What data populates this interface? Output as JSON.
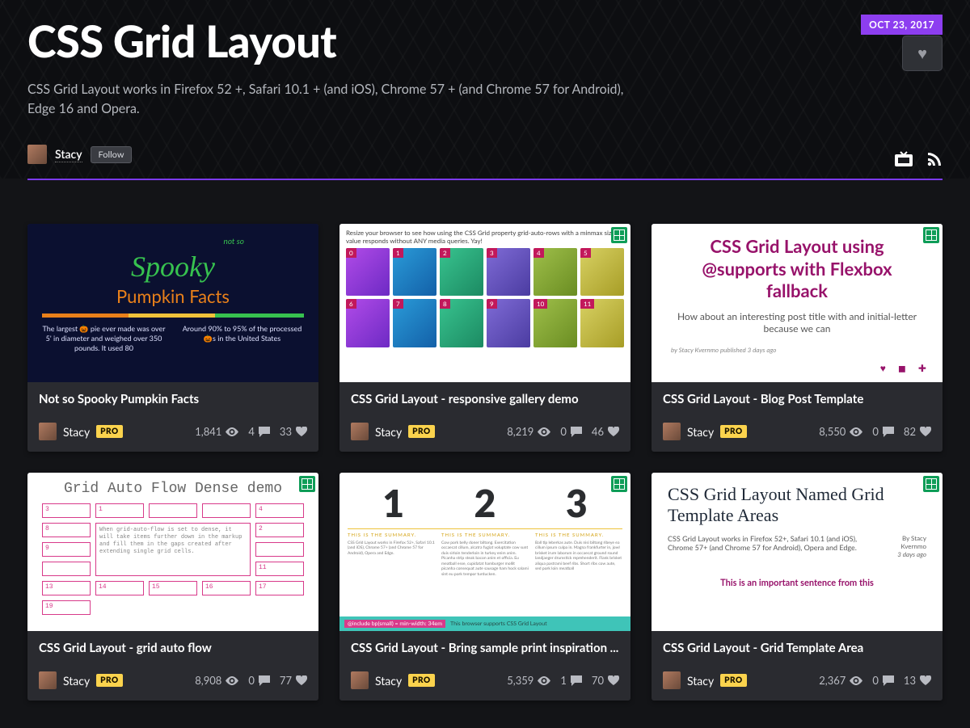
{
  "hero": {
    "date": "OCT 23, 2017",
    "title": "CSS Grid Layout",
    "subtitle": "CSS Grid Layout works in Firefox 52 +, Safari 10.1 + (and iOS), Chrome 57 + (and Chrome 57 for Android), Edge 16 and Opera.",
    "author": "Stacy",
    "follow_label": "Follow"
  },
  "labels": {
    "pro": "PRO"
  },
  "pens": [
    {
      "title": "Not so Spooky Pumpkin Facts",
      "author": "Stacy",
      "pro": true,
      "views": "1,841",
      "comments": "4",
      "loves": "33",
      "grid_badge": false,
      "thumb": "spooky"
    },
    {
      "title": "CSS Grid Layout - responsive gallery demo",
      "author": "Stacy",
      "pro": true,
      "views": "8,219",
      "comments": "0",
      "loves": "46",
      "grid_badge": true,
      "thumb": "gallery"
    },
    {
      "title": "CSS Grid Layout - Blog Post Template",
      "author": "Stacy",
      "pro": true,
      "views": "8,550",
      "comments": "0",
      "loves": "82",
      "grid_badge": true,
      "thumb": "blog"
    },
    {
      "title": "CSS Grid Layout - grid auto flow",
      "author": "Stacy",
      "pro": true,
      "views": "8,908",
      "comments": "0",
      "loves": "77",
      "grid_badge": true,
      "thumb": "dense"
    },
    {
      "title": "CSS Grid Layout - Bring sample print inspiration ...",
      "author": "Stacy",
      "pro": true,
      "views": "5,359",
      "comments": "1",
      "loves": "70",
      "grid_badge": true,
      "thumb": "print"
    },
    {
      "title": "CSS Grid Layout - Grid Template Area",
      "author": "Stacy",
      "pro": true,
      "views": "2,367",
      "comments": "0",
      "loves": "13",
      "grid_badge": true,
      "thumb": "area"
    }
  ],
  "thumbs": {
    "spooky": {
      "pre": "not so",
      "l1": "Spooky",
      "l2": "Pumpkin Facts",
      "f1": "The largest 🎃 pie ever made was over 5' in diameter and weighed over 350 pounds. It used 80",
      "f2": "Around 90% to 95% of the processed 🎃s in the United States"
    },
    "gallery": {
      "text": "Resize your browser to see how using the CSS Grid property grid-auto-rows with a minmax sizing value responds without ANY media queries. Yay!"
    },
    "blog": {
      "h": "CSS Grid Layout using @supports with Flexbox fallback",
      "p": "How about an interesting post title with and initial-letter because we can",
      "meta": "by Stacy Kvernmo published 3 days ago"
    },
    "dense": {
      "h": "Grid Auto Flow Dense demo",
      "note": "When grid-auto-flow is set to dense, it will take items further down in the markup and fill them in the gaps created after extending single grid cells."
    },
    "print": {
      "h": "THIS IS THE SUMMARY.",
      "c1": "CSS Grid Layout works in Firefox 52+, Safari 10.1 (and iOS), Chrome 57+ (and Chrome 57 for Android), Opera and Edge.",
      "c2": "Cow pork belly doner biltong. Exercitation occaecat cillum, alcatra fugiat voluptate cow sunt duis sirloin tenderloin in turkey enim anim. Picanha strip steak bacon anim et officia. Eu meatball esse, cupidatat hamburger mollit picanha consequat aute sausage ham hock salami sint eu pork tempor turducken.",
      "c3": "Ball tip leberkas aute. Duis nisi biltong ribeye ea cillum ipsum culpa in. Magna frankfurter in, jowl brisket irure laborum in occaecat ground round landjaeger drumstick reprehenderit. Flank brisket aliqua pastrami beef ribs. Short ribs cow aute, sed pork loin meatball",
      "band1": "@include bp(small) = min-width: 34em",
      "band2": "This browser supports CSS Grid Layout"
    },
    "area": {
      "h": "CSS Grid Layout Named Grid Template Areas",
      "p": "CSS Grid Layout works in Firefox 52+, Safari 10.1 (and iOS), Chrome 57+ (and Chrome 57 for Android), Opera and Edge.",
      "by1": "By Stacy Kvernmo",
      "by2": "3 days ago",
      "imp": "This is an important sentence from this"
    }
  }
}
